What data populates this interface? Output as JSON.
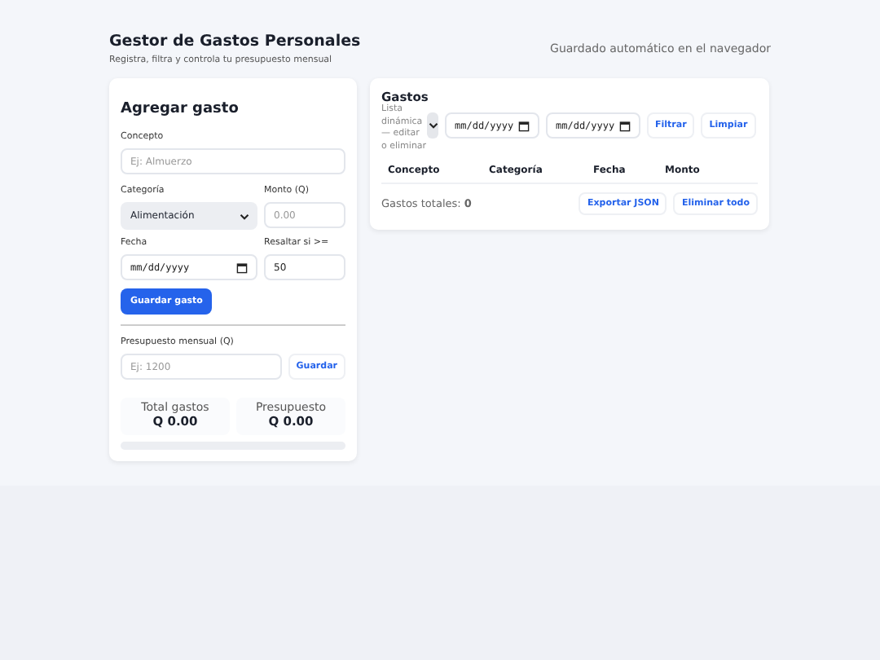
{
  "header": {
    "title": "Gestor de Gastos Personales",
    "subtitle": "Registra, filtra y controla tu presupuesto mensual",
    "autosave": "Guardado automático en el navegador"
  },
  "add_form": {
    "title": "Agregar gasto",
    "concept": {
      "label": "Concepto",
      "placeholder": "Ej: Almuerzo"
    },
    "category": {
      "label": "Categoría",
      "value": "Alimentación"
    },
    "amount": {
      "label": "Monto (Q)",
      "placeholder": "0.00"
    },
    "date": {
      "label": "Fecha",
      "value": "mm/dd/yyyy"
    },
    "highlight": {
      "label": "Resaltar si >=",
      "value": "50"
    },
    "save_button": "Guardar gasto"
  },
  "budget": {
    "label": "Presupuesto mensual (Q)",
    "placeholder": "Ej: 1200",
    "save_button": "Guardar",
    "stats": [
      {
        "label": "Total gastos",
        "value": "Q 0.00"
      },
      {
        "label": "Presupuesto",
        "value": "Q 0.00"
      }
    ],
    "level": 0
  },
  "expenses": {
    "title": "Gastos",
    "note": "Lista dinámica — editar o eliminar",
    "date_from": "mm/dd/yyyy",
    "date_to": "mm/dd/yyyy",
    "filter_button": "Filtrar",
    "clear_button": "Limpiar",
    "columns": [
      "Concepto",
      "Categoría",
      "Fecha",
      "Monto"
    ],
    "total": "Gastos totales: **0**",
    "export_button": "Exportar JSON",
    "delete_all_button": "Eliminar todo"
  }
}
